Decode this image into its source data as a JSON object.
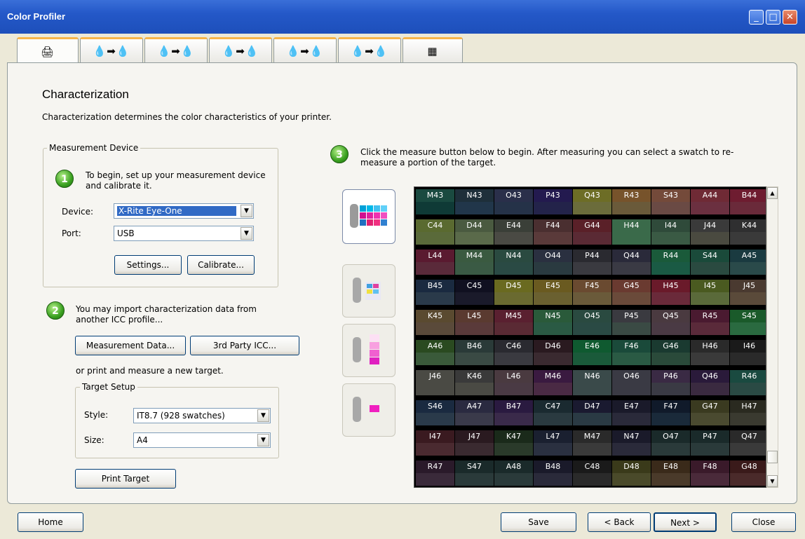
{
  "window": {
    "title": "Color Profiler"
  },
  "tabs": [
    {
      "glyph": "🖨"
    },
    {
      "glyph": "💧➡💧"
    },
    {
      "glyph": "💧➡💧"
    },
    {
      "glyph": "💧➡💧"
    },
    {
      "glyph": "💧➡💧"
    },
    {
      "glyph": "💧➡💧"
    },
    {
      "glyph": "▦"
    }
  ],
  "page": {
    "title": "Characterization",
    "subtitle": "Characterization determines the color characteristics of your printer."
  },
  "measurement": {
    "legend": "Measurement Device",
    "step1": "To begin, set up your measurement device and calibrate it.",
    "device_label": "Device:",
    "device_value": "X-Rite Eye-One",
    "port_label": "Port:",
    "port_value": "USB",
    "settings": "Settings...",
    "calibrate": "Calibrate..."
  },
  "import": {
    "step2": "You may import characterization data from another ICC profile...",
    "measurement_data": "Measurement Data...",
    "third_party": "3rd Party ICC...",
    "or_print": "or print and measure a new target."
  },
  "target": {
    "legend": "Target Setup",
    "style_label": "Style:",
    "style_value": "IT8.7 (928 swatches)",
    "size_label": "Size:",
    "size_value": "A4",
    "print": "Print Target"
  },
  "step3": {
    "text": "Click the measure button below to begin. After measuring you can select a swatch to re-measure a portion of the target."
  },
  "swatch_rows": [
    {
      "labels": [
        "M43",
        "N43",
        "O43",
        "P43",
        "Q43",
        "R43",
        "S43",
        "A44",
        "B44"
      ],
      "label_colors": [
        "#1a4a40",
        "#1e2f3a",
        "#2a2f4a",
        "#231a4f",
        "#6d6d26",
        "#77532b",
        "#744a3a",
        "#6f2a35",
        "#6e1c30"
      ],
      "swatch_colors": [
        "#0f3a36",
        "#21364a",
        "#253248",
        "#23234a",
        "#6b6c3b",
        "#6a5a3a",
        "#6a4a44",
        "#6b3040",
        "#6a2a3a"
      ]
    },
    {
      "labels": [
        "C44",
        "D44",
        "E44",
        "F44",
        "G44",
        "H44",
        "I44",
        "J44",
        "K44"
      ],
      "label_colors": [
        "#5a6a30",
        "#4a5a40",
        "#3a3f38",
        "#4a2f30",
        "#5a2028",
        "#3a6a4a",
        "#2f4a3a",
        "#3a3a3a",
        "#2f2f30"
      ],
      "swatch_colors": [
        "#5a6a3a",
        "#5a6a4a",
        "#4a4a44",
        "#5a3a3a",
        "#5a2a34",
        "#3a6a4a",
        "#3a5a44",
        "#4a4a40",
        "#3a3a3a"
      ]
    },
    {
      "labels": [
        "L44",
        "M44",
        "N44",
        "O44",
        "P44",
        "Q44",
        "R44",
        "S44",
        "A45"
      ],
      "label_colors": [
        "#5a1a30",
        "#3a5a40",
        "#2a4a40",
        "#2a3040",
        "#2a2a30",
        "#2a2a3a",
        "#1a5a3a",
        "#1a4a3a",
        "#1a3a40"
      ],
      "swatch_colors": [
        "#5a2a3a",
        "#3a5a44",
        "#2a4a44",
        "#2a3a40",
        "#3a3a40",
        "#3a3a44",
        "#1a5a44",
        "#2a4a40",
        "#2a4a4a"
      ]
    },
    {
      "labels": [
        "B45",
        "C45",
        "D45",
        "E45",
        "F45",
        "G45",
        "H45",
        "I45",
        "J45"
      ],
      "label_colors": [
        "#1a2a40",
        "#101020",
        "#6a6a20",
        "#6a5a20",
        "#6a4a30",
        "#6a3a30",
        "#6a1a2a",
        "#4a5a20",
        "#4a3a30"
      ],
      "swatch_colors": [
        "#2a3a4a",
        "#1a1a2a",
        "#6a6a30",
        "#6a6030",
        "#6a5a3a",
        "#6a4a3a",
        "#6a2a3a",
        "#5a6a3a",
        "#5a4a3a"
      ]
    },
    {
      "labels": [
        "K45",
        "L45",
        "M45",
        "N45",
        "O45",
        "P45",
        "Q45",
        "R45",
        "S45"
      ],
      "label_colors": [
        "#5a4a30",
        "#5a3a30",
        "#5a2030",
        "#2a5a3a",
        "#2a4a40",
        "#3a3a40",
        "#4a3a40",
        "#4a1a30",
        "#1a5a2a"
      ],
      "swatch_colors": [
        "#5a4a3a",
        "#5a3a3a",
        "#5a2a34",
        "#2a5a44",
        "#2a4a44",
        "#3a4a44",
        "#4a3a44",
        "#5a2a3a",
        "#2a6a40"
      ]
    },
    {
      "labels": [
        "A46",
        "B46",
        "C46",
        "D46",
        "E46",
        "F46",
        "G46",
        "H46",
        "I46"
      ],
      "label_colors": [
        "#2a4a20",
        "#2a3a38",
        "#2a2a30",
        "#2a1a20",
        "#0f5a30",
        "#1a4a3a",
        "#1a3a30",
        "#2a2a2a",
        "#1a1a1a"
      ],
      "swatch_colors": [
        "#3a5a3a",
        "#3a4a44",
        "#3a3a40",
        "#3a2a30",
        "#1a5a3a",
        "#2a5a44",
        "#2a4a3a",
        "#3a3a3a",
        "#2a2a2a"
      ]
    },
    {
      "labels": [
        "J46",
        "K46",
        "L46",
        "M46",
        "N46",
        "O46",
        "P46",
        "Q46",
        "R46"
      ],
      "label_colors": [
        "#4a4a44",
        "#3a3a3a",
        "#4a3a40",
        "#3a1a40",
        "#3a4a4a",
        "#3a3a44",
        "#3a2a44",
        "#2a1a3a",
        "#1a4a40"
      ],
      "swatch_colors": [
        "#4a4a44",
        "#4a4a44",
        "#4a3a44",
        "#4a2a44",
        "#3a4a4a",
        "#3a3a44",
        "#3a3a44",
        "#3a2a40",
        "#2a4a44"
      ]
    },
    {
      "labels": [
        "S46",
        "A47",
        "B47",
        "C47",
        "D47",
        "E47",
        "F47",
        "G47",
        "H47"
      ],
      "label_colors": [
        "#1a2a40",
        "#2a2a40",
        "#2a1a40",
        "#1a2a30",
        "#1a1a30",
        "#1a1a2a",
        "#101a2a",
        "#3a3a20",
        "#2a2a20"
      ],
      "swatch_colors": [
        "#2a3a4a",
        "#3a3a4a",
        "#3a2a4a",
        "#2a3a40",
        "#2a3a44",
        "#2a2a3a",
        "#1a2a3a",
        "#4a4a30",
        "#3a3a30"
      ]
    },
    {
      "labels": [
        "I47",
        "J47",
        "K47",
        "L47",
        "M47",
        "N47",
        "O47",
        "P47",
        "Q47"
      ],
      "label_colors": [
        "#3a1a20",
        "#2a1a20",
        "#1a2a1a",
        "#1a2030",
        "#2a2a2a",
        "#1a1a2a",
        "#1a2a2a",
        "#1a2a2a",
        "#2a2a2a"
      ],
      "swatch_colors": [
        "#4a2a30",
        "#3a2a30",
        "#2a3a2a",
        "#2a3040",
        "#3a3a3a",
        "#2a2a3a",
        "#2a3a3a",
        "#2a3a3a",
        "#3a3a3a"
      ]
    },
    {
      "labels": [
        "R47",
        "S47",
        "A48",
        "B48",
        "C48",
        "D48",
        "E48",
        "F48",
        "G48"
      ],
      "label_colors": [
        "#2a1a2a",
        "#1a2a2a",
        "#1a2a2a",
        "#1a1a2a",
        "#1a1a1a",
        "#3a3a1a",
        "#3a2a1a",
        "#3a1a2a",
        "#3a1a1a"
      ],
      "swatch_colors": [
        "#3a2a3a",
        "#2a3a3a",
        "#2a3a3a",
        "#2a2a3a",
        "#2a2a2a",
        "#4a4a2a",
        "#4a3a2a",
        "#4a2a3a",
        "#4a2a2a"
      ]
    }
  ],
  "footer": {
    "home": "Home",
    "save": "Save",
    "back": "< Back",
    "next": "Next >",
    "close": "Close"
  }
}
